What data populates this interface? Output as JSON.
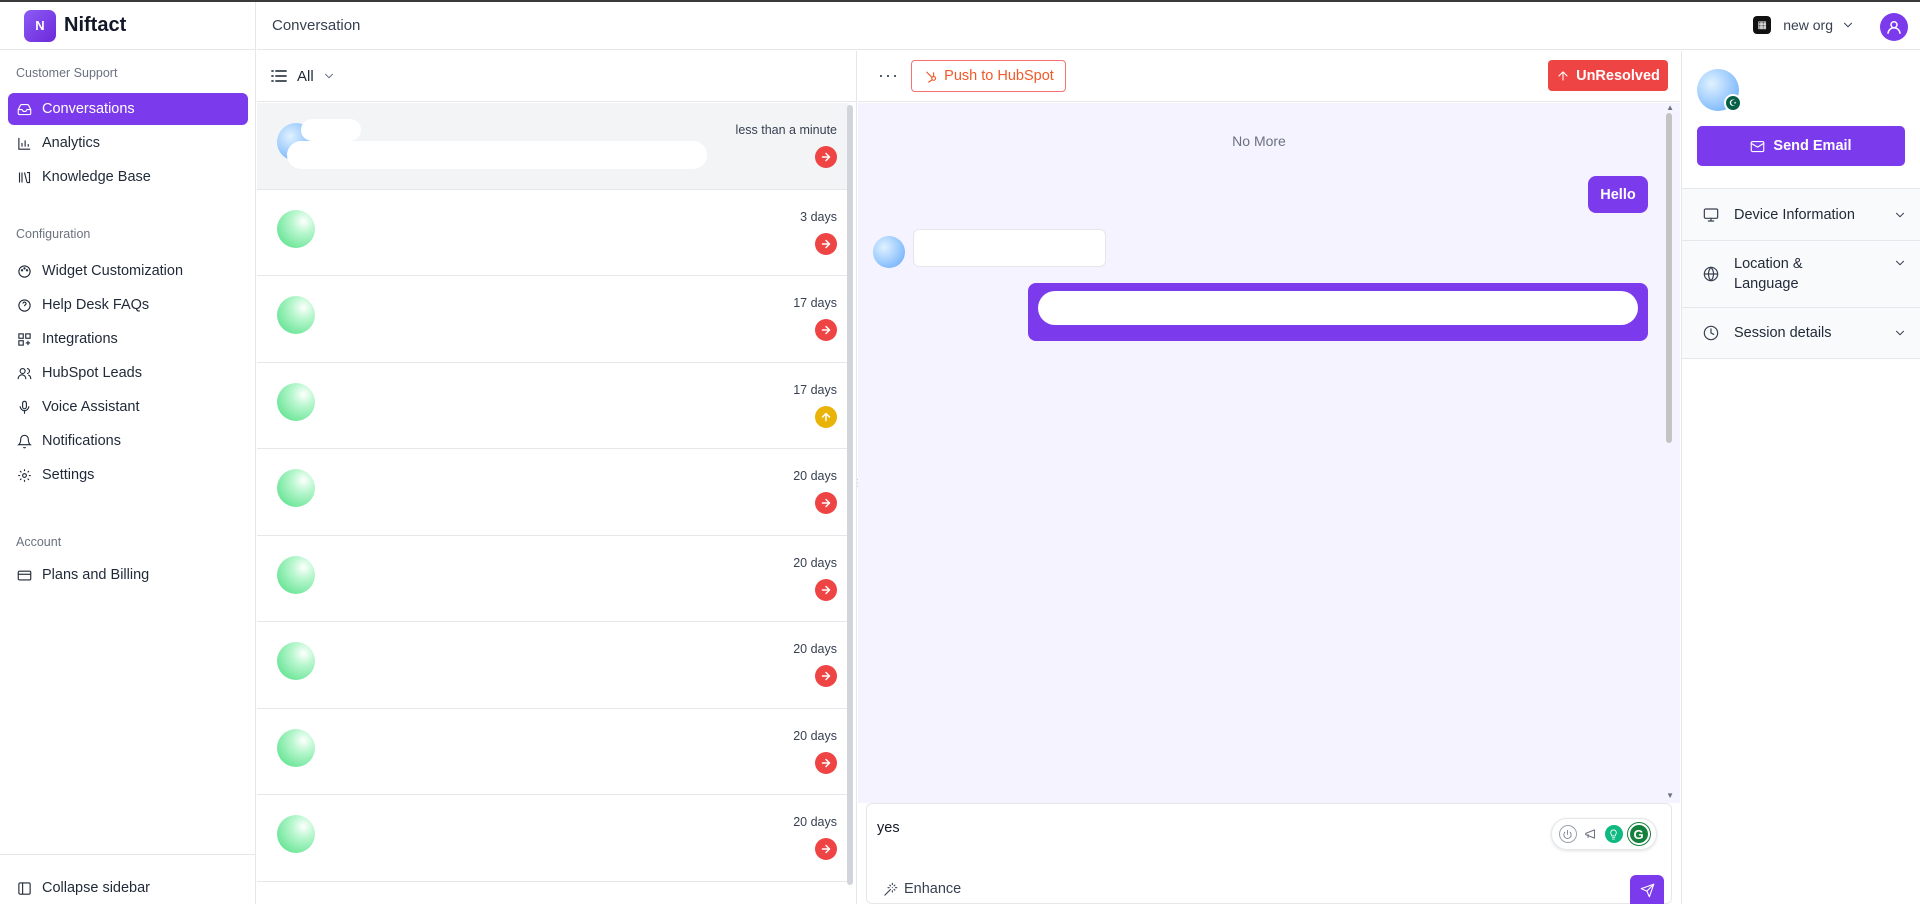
{
  "brand": {
    "logo_letter": "N",
    "name": "Niftact"
  },
  "sidebar": {
    "sections": [
      {
        "label": "Customer Support",
        "items": [
          {
            "label": "Conversations",
            "icon": "inbox-icon",
            "active": true
          },
          {
            "label": "Analytics",
            "icon": "bar-chart-icon"
          },
          {
            "label": "Knowledge Base",
            "icon": "library-icon"
          }
        ]
      },
      {
        "label": "Configuration",
        "items": [
          {
            "label": "Widget Customization",
            "icon": "palette-icon"
          },
          {
            "label": "Help Desk FAQs",
            "icon": "help-circle-icon"
          },
          {
            "label": "Integrations",
            "icon": "grid-plus-icon"
          },
          {
            "label": "HubSpot Leads",
            "icon": "users-icon"
          },
          {
            "label": "Voice Assistant",
            "icon": "mic-icon"
          },
          {
            "label": "Notifications",
            "icon": "bell-icon"
          },
          {
            "label": "Settings",
            "icon": "gear-icon"
          }
        ]
      },
      {
        "label": "Account",
        "items": [
          {
            "label": "Plans and Billing",
            "icon": "credit-card-icon"
          }
        ]
      }
    ],
    "collapse_label": "Collapse sidebar"
  },
  "topbar": {
    "title": "Conversation",
    "org_name": "new org"
  },
  "list": {
    "filter_label": "All",
    "conversations": [
      {
        "time": "less than a minute",
        "status": "red"
      },
      {
        "time": "3 days",
        "status": "red"
      },
      {
        "time": "17 days",
        "status": "red"
      },
      {
        "time": "17 days",
        "status": "amber"
      },
      {
        "time": "20 days",
        "status": "red"
      },
      {
        "time": "20 days",
        "status": "red"
      },
      {
        "time": "20 days",
        "status": "red"
      },
      {
        "time": "20 days",
        "status": "red"
      },
      {
        "time": "20 days",
        "status": "red"
      }
    ]
  },
  "chat": {
    "push_label": "Push to HubSpot",
    "status_label": "UnResolved",
    "no_more": "No More",
    "outgoing_message": "Hello",
    "composer_value": "yes",
    "enhance_label": "Enhance"
  },
  "info": {
    "send_email_label": "Send Email",
    "sections": [
      {
        "label": "Device Information"
      },
      {
        "label": "Location &\nLanguage"
      },
      {
        "label": "Session details"
      }
    ]
  },
  "colors": {
    "accent": "#7c3aed",
    "danger": "#ef4444",
    "warning": "#eab308",
    "hubspot": "#f05a28",
    "chat_bg": "#f5f3ff"
  }
}
